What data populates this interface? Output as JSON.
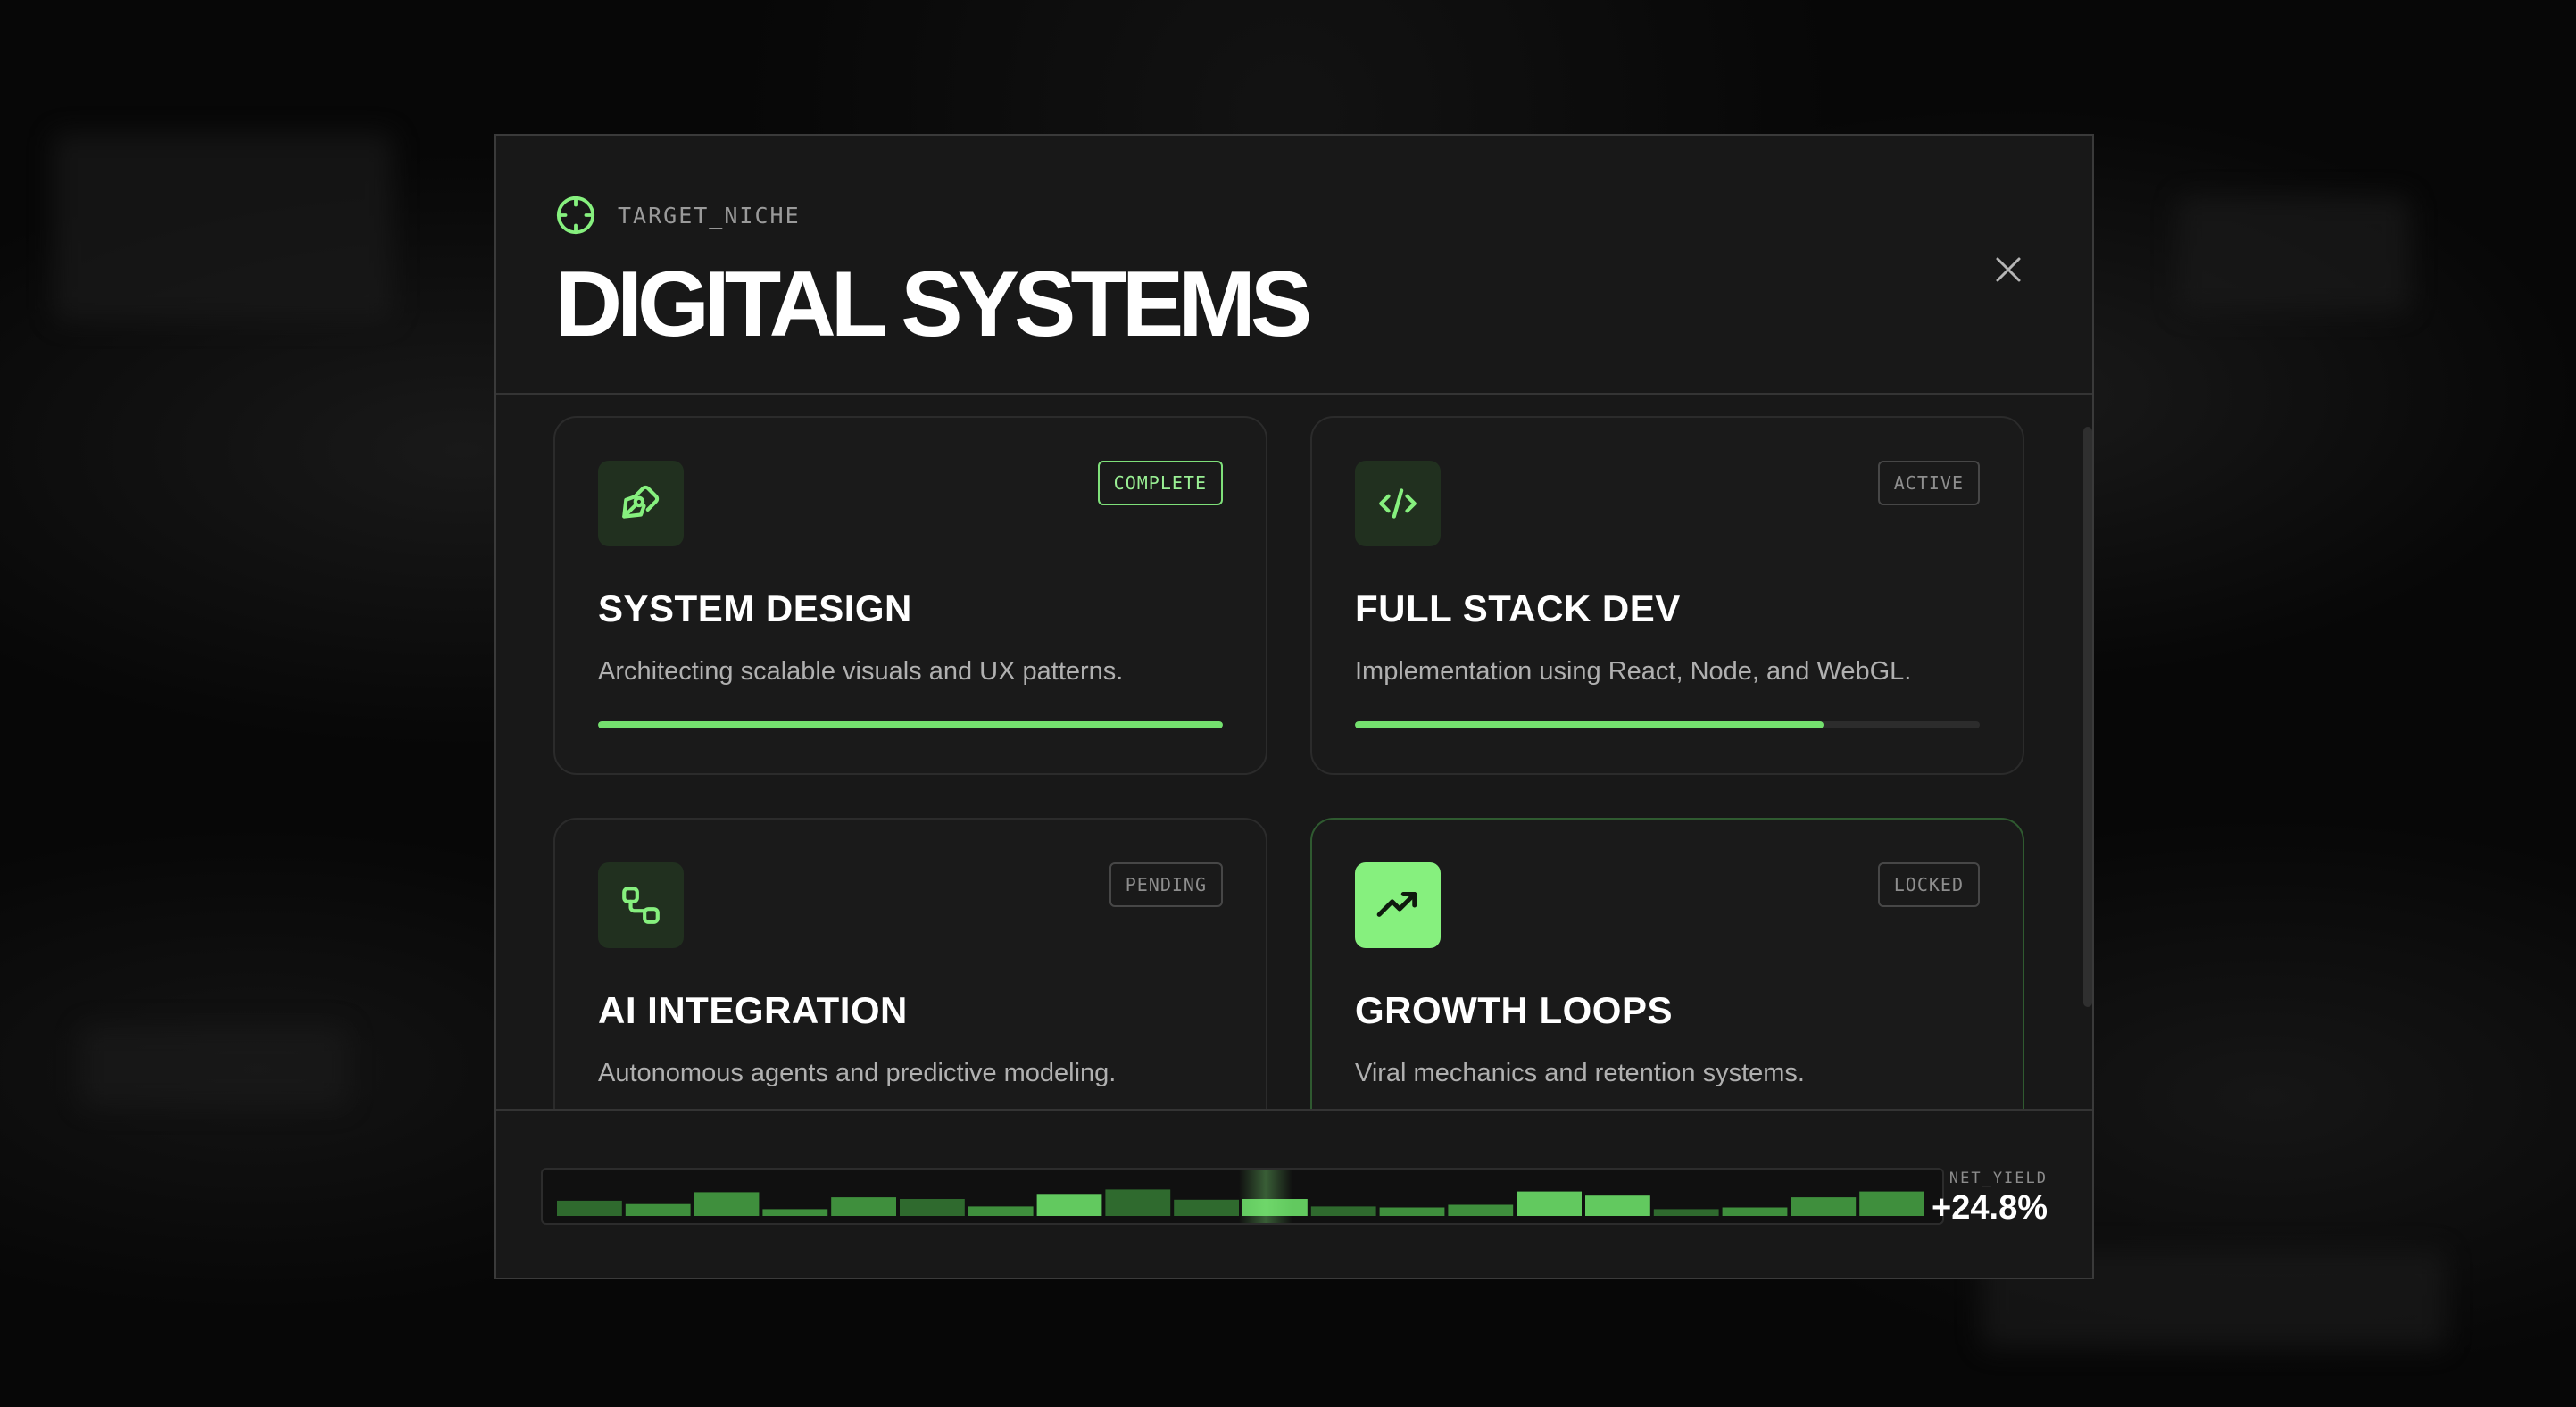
{
  "header": {
    "niche_label": "TARGET_NICHE",
    "title": "DIGITAL SYSTEMS",
    "niche_icon": "crosshair-icon",
    "close_icon": "close-icon"
  },
  "cards": [
    {
      "title": "SYSTEM DESIGN",
      "description": "Architecting scalable visuals and UX patterns.",
      "status": "COMPLETE",
      "icon": "pen-tool-icon",
      "progress": 1.0
    },
    {
      "title": "FULL STACK DEV",
      "description": "Implementation using React, Node, and WebGL.",
      "status": "ACTIVE",
      "icon": "code-icon",
      "progress": 0.75
    },
    {
      "title": "AI INTEGRATION",
      "description": "Autonomous agents and predictive modeling.",
      "status": "PENDING",
      "icon": "workflow-icon"
    },
    {
      "title": "GROWTH LOOPS",
      "description": "Viral mechanics and retention systems.",
      "status": "LOCKED",
      "icon": "trending-up-icon"
    }
  ],
  "footer": {
    "yield_label": "NET_YIELD",
    "yield_value": "+24.8%"
  },
  "colors": {
    "accent": "#86f07e",
    "progress": "#74e06e",
    "background": "#181818"
  },
  "chart_data": {
    "type": "bar",
    "values": [
      0.45,
      0.35,
      0.7,
      0.2,
      0.55,
      0.5,
      0.28,
      0.65,
      0.78,
      0.48,
      0.5,
      0.28,
      0.25,
      0.33,
      0.72,
      0.6,
      0.2,
      0.25,
      0.55,
      0.72
    ],
    "brightness": [
      1,
      2,
      2,
      2,
      2,
      1,
      2,
      3,
      1,
      1,
      3,
      1,
      2,
      2,
      3,
      3,
      1,
      2,
      2,
      2
    ]
  }
}
